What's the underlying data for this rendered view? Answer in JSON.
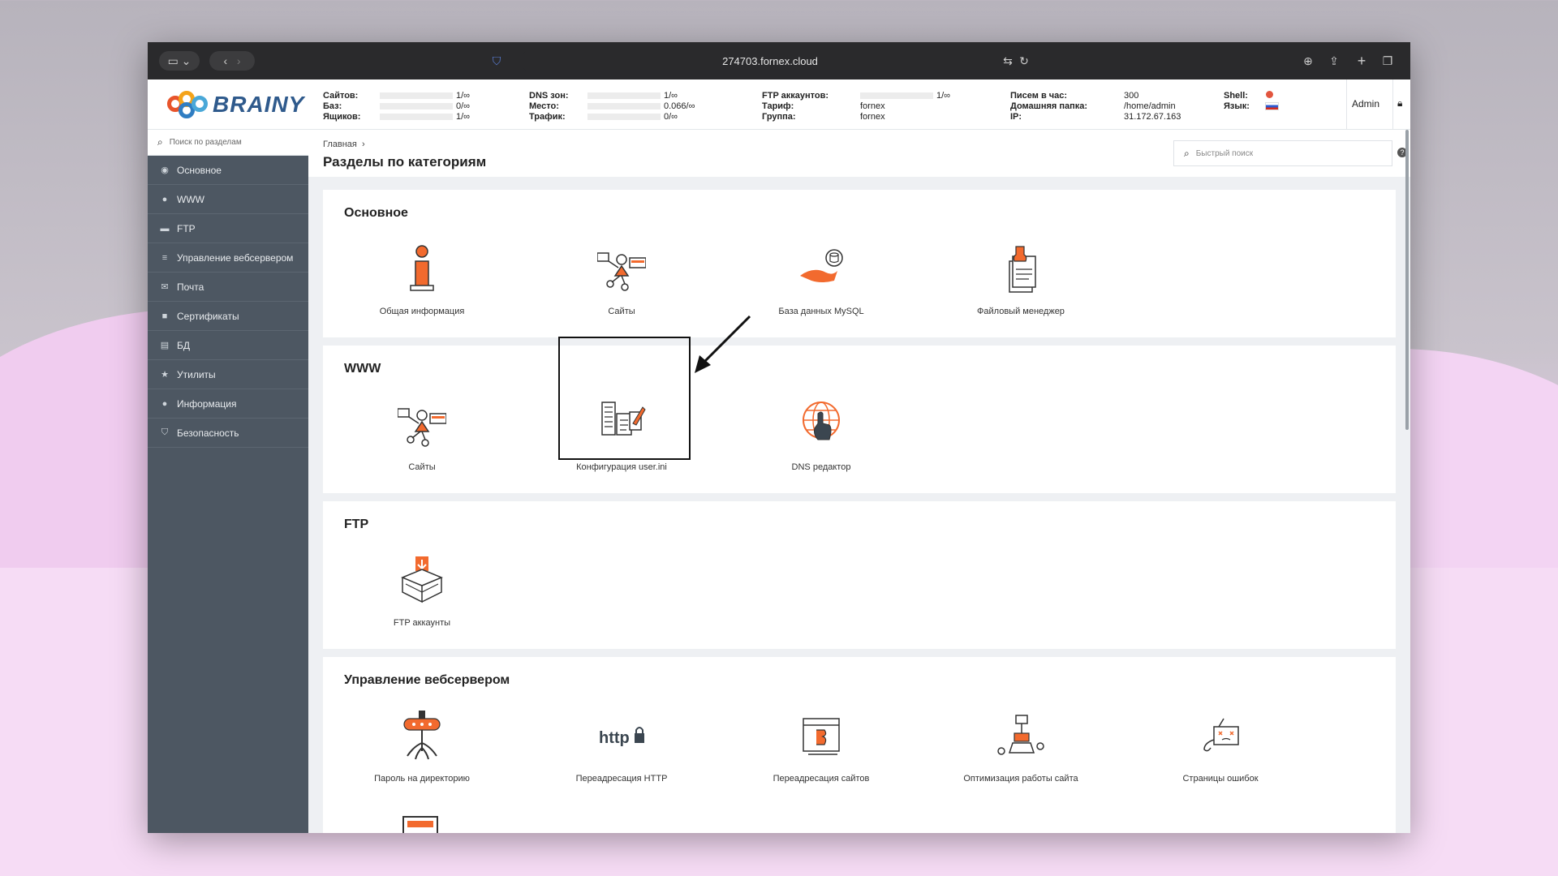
{
  "browser": {
    "url": "274703.fornex.cloud"
  },
  "header": {
    "logo_text": "BRAINY",
    "stats": {
      "sites_label": "Сайтов:",
      "sites_value": "1/∞",
      "dbs_label": "Баз:",
      "dbs_value": "0/∞",
      "mail_label": "Ящиков:",
      "mail_value": "1/∞",
      "dns_label": "DNS зон:",
      "dns_value": "1/∞",
      "space_label": "Место:",
      "space_value": "0.066/∞",
      "traffic_label": "Трафик:",
      "traffic_value": "0/∞",
      "ftp_label": "FTP аккаунтов:",
      "ftp_value": "1/∞",
      "tariff_label": "Тариф:",
      "tariff_value": "fornex",
      "group_label": "Группа:",
      "group_value": "fornex",
      "letters_label": "Писем в час:",
      "letters_value": "300",
      "home_label": "Домашняя папка:",
      "home_value": "/home/admin",
      "ip_label": "IP:",
      "ip_value": "31.172.67.163",
      "shell_label": "Shell:",
      "lang_label": "Язык:"
    },
    "user": "Admin"
  },
  "sidebar": {
    "search_placeholder": "Поиск по разделам",
    "items": [
      {
        "label": "Основное",
        "icon": "dashboard-icon"
      },
      {
        "label": "WWW",
        "icon": "globe-icon"
      },
      {
        "label": "FTP",
        "icon": "folder-icon"
      },
      {
        "label": "Управление вебсервером",
        "icon": "server-icon"
      },
      {
        "label": "Почта",
        "icon": "mail-icon"
      },
      {
        "label": "Сертификаты",
        "icon": "lock-icon"
      },
      {
        "label": "БД",
        "icon": "database-icon"
      },
      {
        "label": "Утилиты",
        "icon": "star-icon"
      },
      {
        "label": "Информация",
        "icon": "info-icon"
      },
      {
        "label": "Безопасность",
        "icon": "shield-icon"
      }
    ]
  },
  "main": {
    "breadcrumb": "Главная",
    "title": "Разделы по категориям",
    "quick_search_placeholder": "Быстрый поиск",
    "sections": [
      {
        "title": "Основное",
        "tiles": [
          "Общая информация",
          "Сайты",
          "База данных MySQL",
          "Файловый менеджер"
        ]
      },
      {
        "title": "WWW",
        "tiles": [
          "Сайты",
          "Конфигурация user.ini",
          "DNS редактор"
        ]
      },
      {
        "title": "FTP",
        "tiles": [
          "FTP аккаунты"
        ]
      },
      {
        "title": "Управление вебсервером",
        "tiles": [
          "Пароль на директорию",
          "Переадресация HTTP",
          "Переадресация сайтов",
          "Оптимизация работы сайта",
          "Страницы ошибок"
        ]
      }
    ]
  },
  "colors": {
    "accent_orange": "#f26a2e",
    "sidebar_bg": "#4d5762",
    "logo_blue": "#2f5a8c"
  }
}
